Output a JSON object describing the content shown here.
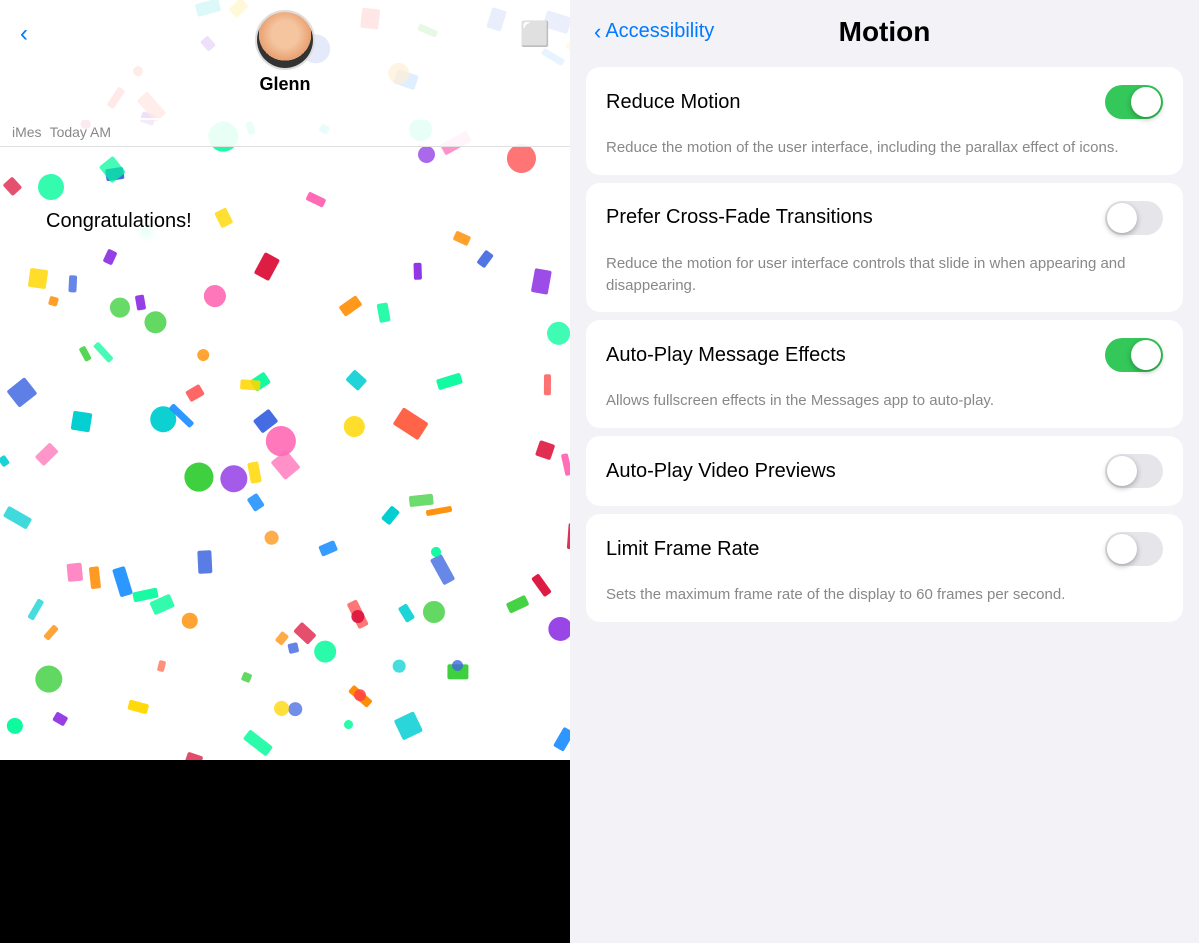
{
  "left": {
    "contact_name": "Glenn",
    "message_app": "iMes",
    "message_time": "Today AM",
    "congratulations": "Congratulations!"
  },
  "right": {
    "back_label": "Accessibility",
    "page_title": "Motion",
    "settings": [
      {
        "id": "reduce-motion",
        "label": "Reduce Motion",
        "enabled": true,
        "description": "Reduce the motion of the user interface, including the parallax effect of icons."
      },
      {
        "id": "cross-fade",
        "label": "Prefer Cross-Fade Transitions",
        "enabled": false,
        "description": "Reduce the motion for user interface controls that slide in when appearing and disappearing."
      },
      {
        "id": "auto-play-message",
        "label": "Auto-Play Message Effects",
        "enabled": true,
        "description": "Allows fullscreen effects in the Messages app to auto-play."
      },
      {
        "id": "auto-play-video",
        "label": "Auto-Play Video Previews",
        "enabled": false,
        "description": ""
      },
      {
        "id": "limit-frame-rate",
        "label": "Limit Frame Rate",
        "enabled": false,
        "description": "Sets the maximum frame rate of the display to 60 frames per second."
      }
    ]
  }
}
